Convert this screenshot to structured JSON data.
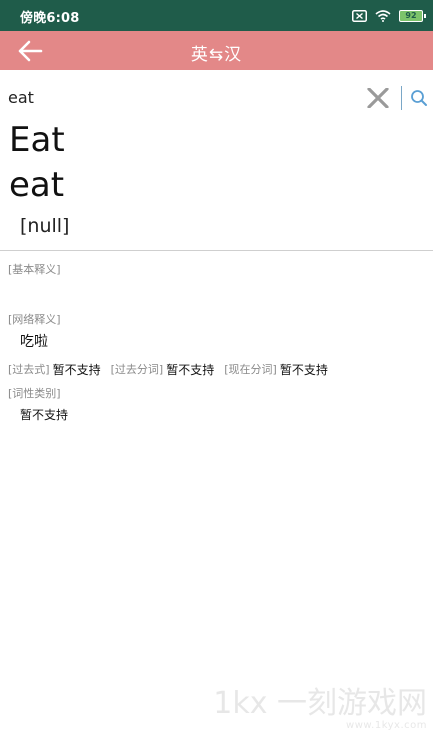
{
  "status_bar": {
    "time": "傍晚6:08",
    "battery": "92"
  },
  "header": {
    "title": "英⇆汉"
  },
  "search": {
    "value": "eat"
  },
  "result": {
    "word_main": "Eat",
    "word_lower": "eat",
    "phonetic": "[null]",
    "basic_label": "[基本释义]",
    "net_label": "[网络释义]",
    "net_value": "吃啦",
    "forms": [
      {
        "label": "[过去式]",
        "value": "暂不支持"
      },
      {
        "label": "[过去分词]",
        "value": "暂不支持"
      },
      {
        "label": "[现在分词]",
        "value": "暂不支持"
      }
    ],
    "pos_label": "[词性类别]",
    "pos_value": "暂不支持"
  },
  "watermark": {
    "logo": "1kx 一刻游戏网",
    "url": "www.1kyx.com"
  },
  "colors": {
    "status_bar": "#1f5c4a",
    "header": "#e38888",
    "search_accent": "#5a9fd4"
  }
}
